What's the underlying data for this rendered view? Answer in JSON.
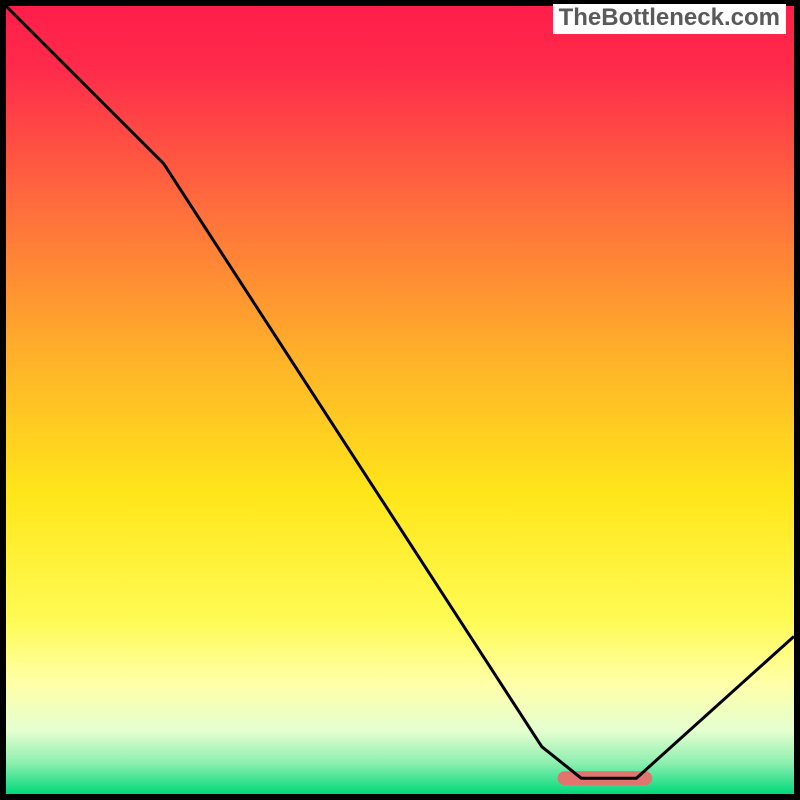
{
  "watermark": "TheBottleneck.com",
  "chart_data": {
    "type": "line",
    "title": "",
    "xlabel": "",
    "ylabel": "",
    "xlim": [
      0,
      100
    ],
    "ylim": [
      0,
      100
    ],
    "grid": false,
    "annotations": [],
    "series": [
      {
        "name": "curve",
        "x": [
          0,
          20,
          68,
          73,
          80,
          100
        ],
        "y": [
          100,
          80,
          6,
          2,
          2,
          20
        ]
      }
    ],
    "optimal_band": {
      "x_start": 70,
      "x_end": 82,
      "y": 2
    },
    "gradient_stops": [
      {
        "offset": 0.0,
        "color": "#ff1e4a"
      },
      {
        "offset": 0.08,
        "color": "#ff2b4b"
      },
      {
        "offset": 0.25,
        "color": "#ff6b3d"
      },
      {
        "offset": 0.45,
        "color": "#ffb329"
      },
      {
        "offset": 0.62,
        "color": "#ffe61a"
      },
      {
        "offset": 0.78,
        "color": "#fffb55"
      },
      {
        "offset": 0.86,
        "color": "#ffffa8"
      },
      {
        "offset": 0.92,
        "color": "#e4ffd0"
      },
      {
        "offset": 0.96,
        "color": "#8fefb0"
      },
      {
        "offset": 1.0,
        "color": "#00d97a"
      }
    ]
  }
}
